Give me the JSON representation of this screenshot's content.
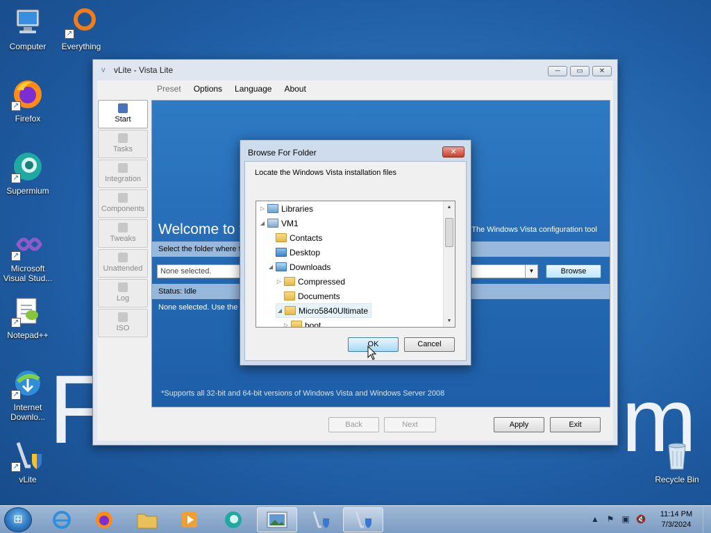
{
  "desktop": {
    "background_text_left": "F",
    "background_text_right": "m",
    "icons": [
      {
        "label": "Computer"
      },
      {
        "label": "Everything"
      },
      {
        "label": "Firefox"
      },
      {
        "label": "Supermium"
      },
      {
        "label": "Microsoft Visual Stud..."
      },
      {
        "label": "Notepad++"
      },
      {
        "label": "Internet Downlo..."
      },
      {
        "label": "vLite"
      },
      {
        "label": "Recycle Bin"
      }
    ]
  },
  "window": {
    "title": "vLite - Vista Lite",
    "controls": {
      "minimize": "─",
      "maximize": "▭",
      "close": "✕"
    },
    "menu": [
      "Preset",
      "Options",
      "Language",
      "About"
    ],
    "sidebar": [
      {
        "label": "Start",
        "icon": "start-icon"
      },
      {
        "label": "Tasks",
        "icon": "tasks-icon"
      },
      {
        "label": "Integration",
        "icon": "integration-icon"
      },
      {
        "label": "Components",
        "icon": "components-icon"
      },
      {
        "label": "Tweaks",
        "icon": "tweaks-icon"
      },
      {
        "label": "Unattended",
        "icon": "unattended-icon"
      },
      {
        "label": "Log",
        "icon": "log-icon"
      },
      {
        "label": "ISO",
        "icon": "iso-icon"
      }
    ],
    "content": {
      "welcome": "Welcome to v",
      "tagline": "The Windows Vista configuration tool",
      "folder_prompt": "Select the folder where th",
      "folder_value": "None selected.",
      "browse_label": "Browse",
      "status": "Status: Idle",
      "info": "None selected. Use the b",
      "footnote": "*Supports all 32-bit and 64-bit versions of Windows Vista and Windows Server 2008"
    },
    "buttons": {
      "back": "Back",
      "next": "Next",
      "apply": "Apply",
      "exit": "Exit"
    }
  },
  "dialog": {
    "title": "Browse For Folder",
    "message": "Locate the Windows Vista installation files",
    "tree": [
      {
        "label": "Libraries",
        "expander": "▷",
        "indent": 0
      },
      {
        "label": "VM1",
        "expander": "◢",
        "indent": 0
      },
      {
        "label": "Contacts",
        "expander": "",
        "indent": 1
      },
      {
        "label": "Desktop",
        "expander": "",
        "indent": 1
      },
      {
        "label": "Downloads",
        "expander": "◢",
        "indent": 1
      },
      {
        "label": "Compressed",
        "expander": "▷",
        "indent": 2
      },
      {
        "label": "Documents",
        "expander": "",
        "indent": 2
      },
      {
        "label": "Micro5840Ultimate",
        "expander": "◢",
        "indent": 2
      },
      {
        "label": "boot",
        "expander": "▷",
        "indent": 3
      }
    ],
    "ok_label": "OK",
    "cancel_label": "Cancel"
  },
  "taskbar": {
    "time": "11:14 PM",
    "date": "7/3/2024"
  }
}
